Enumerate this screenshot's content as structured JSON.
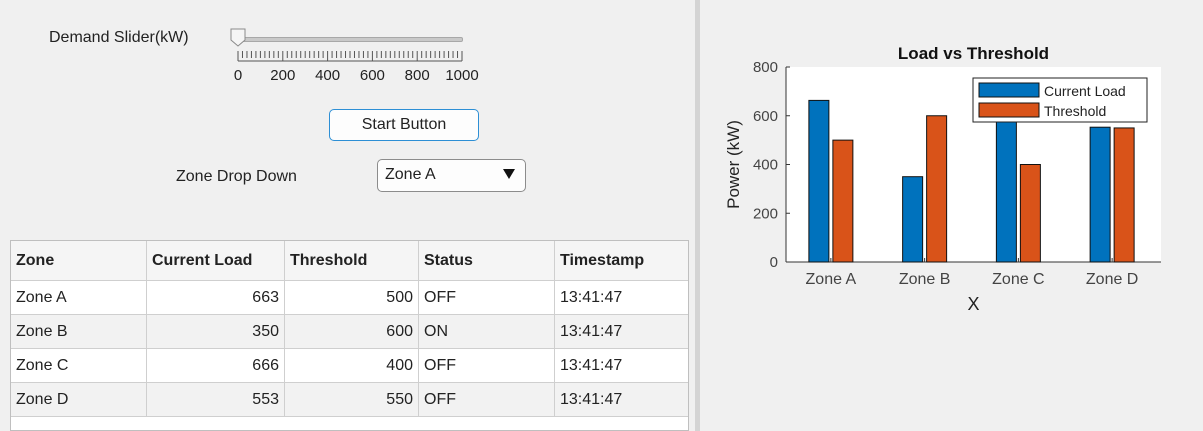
{
  "controls": {
    "slider_label": "Demand Slider(kW)",
    "slider_value": 0,
    "slider_min": 0,
    "slider_max": 1000,
    "slider_ticks": [
      "0",
      "200",
      "400",
      "600",
      "800",
      "1000"
    ],
    "start_button_label": "Start Button",
    "dropdown_label": "Zone Drop Down",
    "dropdown_value": "Zone A"
  },
  "table": {
    "headers": [
      "Zone",
      "Current Load",
      "Threshold",
      "Status",
      "Timestamp"
    ],
    "rows": [
      [
        "Zone A",
        "663",
        "500",
        "OFF",
        "13:41:47"
      ],
      [
        "Zone B",
        "350",
        "600",
        "ON",
        "13:41:47"
      ],
      [
        "Zone C",
        "666",
        "400",
        "OFF",
        "13:41:47"
      ],
      [
        "Zone D",
        "553",
        "550",
        "OFF",
        "13:41:47"
      ]
    ]
  },
  "chart_data": {
    "type": "bar",
    "title": "Load vs Threshold",
    "xlabel": "X",
    "ylabel": "Power (kW)",
    "categories": [
      "Zone A",
      "Zone B",
      "Zone C",
      "Zone D"
    ],
    "ylim": [
      0,
      800
    ],
    "yticks": [
      0,
      200,
      400,
      600,
      800
    ],
    "legend_position": "top-right",
    "series": [
      {
        "name": "Current Load",
        "values": [
          663,
          350,
          666,
          553
        ],
        "color": "#0072bd"
      },
      {
        "name": "Threshold",
        "values": [
          500,
          600,
          400,
          550
        ],
        "color": "#d95319"
      }
    ]
  }
}
